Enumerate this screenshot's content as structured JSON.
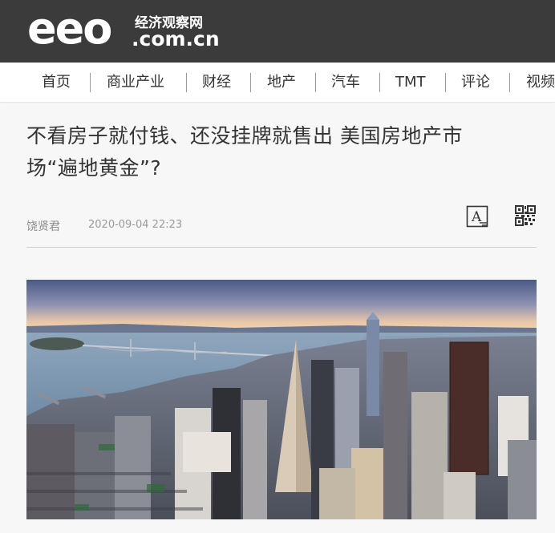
{
  "header": {
    "logo_text": "eeo",
    "logo_cn": "经济观察网",
    "logo_domain": ".com.cn",
    "bg_color": "#3b3b3b"
  },
  "nav": {
    "items": [
      {
        "label": "首页"
      },
      {
        "label": "商业产业"
      },
      {
        "label": "财经"
      },
      {
        "label": "地产"
      },
      {
        "label": "汽车"
      },
      {
        "label": "TMT"
      },
      {
        "label": "评论"
      },
      {
        "label": "视频"
      }
    ]
  },
  "article": {
    "title_line1": "不看房子就付钱、还没挂牌就售出 美国房地产市",
    "title_line2": "场“遍地黄金”?",
    "author": "饶贤君",
    "published": "2020-09-04 22:23",
    "font_size_icon": "font-size-icon",
    "qr_icon": "qr-code-icon",
    "hero_image": "san-francisco-skyline-aerial"
  }
}
